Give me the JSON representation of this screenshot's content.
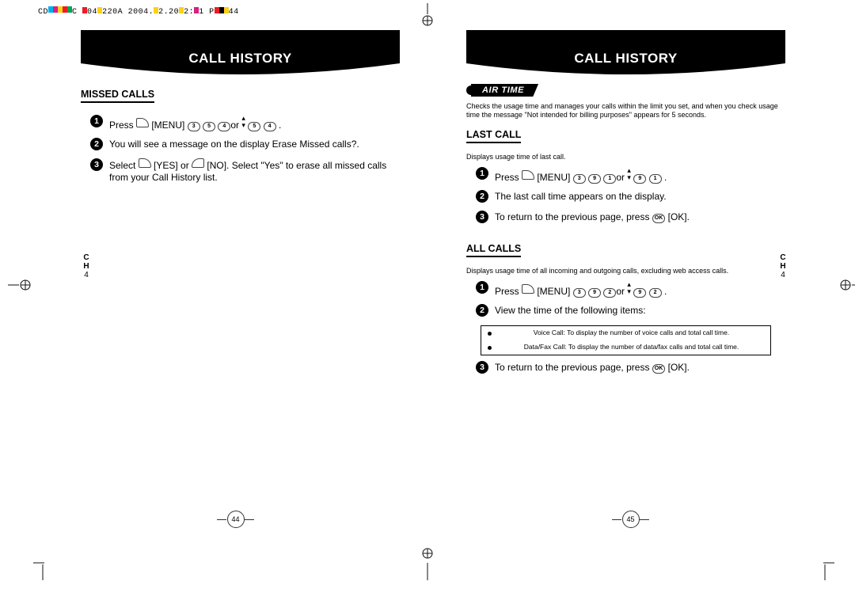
{
  "header_raw_prefix": "CD",
  "header_raw_mid": "C",
  "header_raw_after_swatch2": "04",
  "header_raw_after_swatch3": "220A 2004.",
  "header_raw_seg4": "2.20",
  "header_raw_seg5": "2:",
  "header_raw_seg6": "1 P",
  "header_raw_seg7": "44",
  "tab": {
    "ch": "C\nH",
    "num": "4"
  },
  "left": {
    "title": "CALL HISTORY",
    "section": "MISSED CALLS",
    "steps": {
      "s1_prefix": "Press ",
      "s1_menu": " [MENU] ",
      "s1_or": "or ",
      "s1_end": " .",
      "s2": "You will see a message on the display Erase Missed calls?.",
      "s3": "Select        [YES] or        [NO]. Select \"Yes\" to erase all missed calls from your Call History list."
    },
    "page_no": "44"
  },
  "right": {
    "title": "CALL HISTORY",
    "pill": "AIR TIME",
    "pill_desc": "Checks the usage time and manages your calls within the limit you set, and when you check usage time the message \"Not intended for billing purposes\" appears for 5 seconds.",
    "last_call": {
      "header": "LAST CALL",
      "desc": "Displays usage time of last call.",
      "s1_prefix": "Press ",
      "s1_menu": " [MENU] ",
      "s1_or": "or ",
      "s1_end": " .",
      "s2": "The last call time appears on the display.",
      "s3": "To return to the previous page, press       [OK]."
    },
    "all_calls": {
      "header": "ALL CALLS",
      "desc": "Displays usage time of all incoming and outgoing calls, excluding web access calls.",
      "s1_prefix": "Press ",
      "s1_menu": " [MENU] ",
      "s1_or": "or ",
      "s1_end": " .",
      "s2": "View the time of the following items:",
      "table_row1": "Voice Call: To display the number of voice calls and total call time.",
      "table_row2": "Data/Fax Call: To display the number of data/fax calls and total call time.",
      "s3": "To return to the previous page, press       [OK]."
    },
    "page_no": "45"
  },
  "keys": {
    "menu_soft": "",
    "three": "3",
    "five": "5",
    "four": "4",
    "nine": "9",
    "one81": "1",
    "two": "2",
    "ok": "OK"
  }
}
